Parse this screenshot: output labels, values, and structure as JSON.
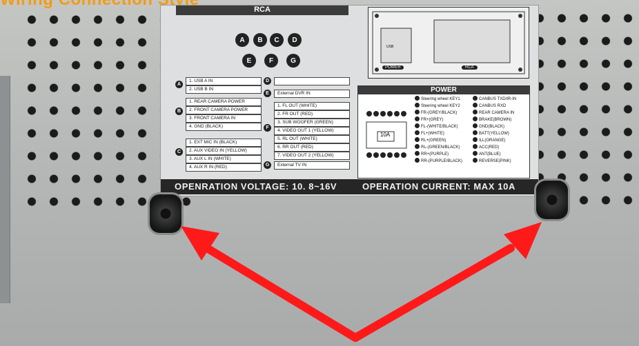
{
  "caption": "Wiring Connection Style",
  "label": {
    "rca_title": "RCA",
    "connector_pins": [
      "A",
      "B",
      "C",
      "D",
      "E",
      "F",
      "G"
    ],
    "groups": {
      "A": [
        "1. USB A IN",
        "2. USB B IN"
      ],
      "B": [
        "1. REAR CAMERA POWER",
        "2. FRONT CAMERA POWER",
        "3. FRONT CAMERA IN",
        "4. GND (BLACK)"
      ],
      "C": [
        "1. EXT MIC IN (BLACK)",
        "2. AUX VIDEO IN (YELLOW)",
        "3. AUX L IN (WHITE)",
        "4. AUX R IN (RED)"
      ],
      "D": [
        ""
      ],
      "E": [
        "External DVR IN"
      ],
      "F": [
        "1. FL OUT (WHITE)",
        "2. FR OUT (RED)",
        "3. SUB WOOFER (GREEN)",
        "4. VIDEO OUT 1 (YELLOW)",
        "5. RL OUT (WHITE)",
        "6. RR OUT (RED)",
        "7. VIDEO OUT 2 (YELLOW)"
      ],
      "G": [
        "External TV IN"
      ]
    },
    "radio_panel": {
      "power_tag": "POWER",
      "rca_tag": "RCA",
      "usb_tag": "USB"
    },
    "power": {
      "title": "POWER",
      "fuse": "10A",
      "left_col": [
        "Steering wheel KEY1",
        "Steering wheel KEY2",
        "FR-(GREY/BLACK)",
        "FR+(GREY)",
        "FL-(WHITE/BLACK)",
        "FL+(WHITE)",
        "RL+(GREEN)",
        "RL-(GREEN/BLACK)",
        "RR+(PURPLE)",
        "RR-(PURPLE/BLACK)"
      ],
      "right_col": [
        "CANBUS TXD/IR-IN",
        "CANBUS RXD",
        "REAR CAMERA IN",
        "BRAKE(BROWN)",
        "GND(BLACK)",
        "BATT(YELLOW)",
        "ILL(ORANGE)",
        "ACC(RED)",
        "ANT(BLUE)",
        "REVERSE(PINK)"
      ]
    },
    "footer_left": "OPENRATION VOLTAGE: 10. 8~16V",
    "footer_right": "OPERATION CURRENT: MAX 10A"
  },
  "colors": {
    "arrow": "#ff1a1a",
    "caption": "#f39c12",
    "label_bg": "#dedfe0",
    "panel_dark": "#262626"
  }
}
